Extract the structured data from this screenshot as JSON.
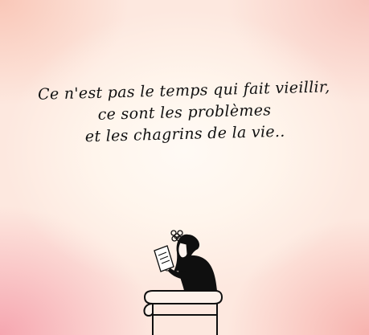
{
  "quote": {
    "line1": "Ce n'est pas le temps qui fait vieillir,",
    "line2": "ce sont les problèmes",
    "line3": "et les chagrins de la vie.."
  },
  "colors": {
    "text": "#111111",
    "background_center": "#fff8f2",
    "background_edges": "#f6a6b0",
    "figure": "#0f0f0f"
  },
  "illustration": {
    "subject": "woman-reading-letter-on-chair-icon"
  }
}
